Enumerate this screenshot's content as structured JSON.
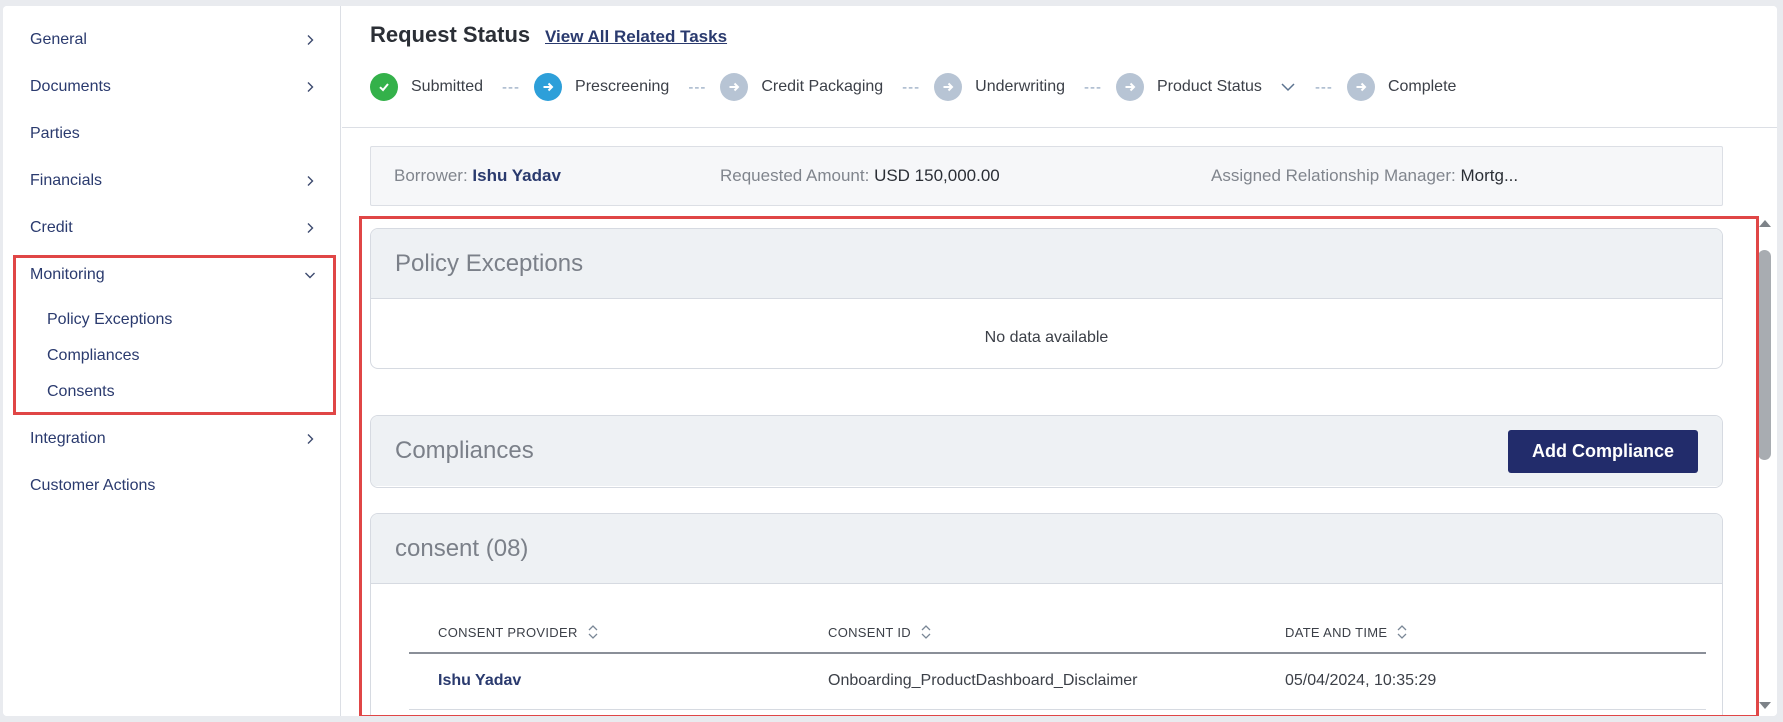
{
  "sidebar": {
    "items": [
      {
        "label": "General",
        "chevron": "right"
      },
      {
        "label": "Documents",
        "chevron": "right"
      },
      {
        "label": "Parties",
        "chevron": ""
      },
      {
        "label": "Financials",
        "chevron": "right"
      },
      {
        "label": "Credit",
        "chevron": "right"
      },
      {
        "label": "Monitoring",
        "chevron": "down"
      },
      {
        "label": "Integration",
        "chevron": "right"
      },
      {
        "label": "Customer Actions",
        "chevron": ""
      }
    ],
    "monitoring_sub": [
      "Policy Exceptions",
      "Compliances",
      "Consents"
    ]
  },
  "header": {
    "title": "Request Status",
    "link": "View All Related Tasks",
    "steps": [
      {
        "label": "Submitted",
        "state": "done"
      },
      {
        "label": "Prescreening",
        "state": "active"
      },
      {
        "label": "Credit Packaging",
        "state": "pending"
      },
      {
        "label": "Underwriting",
        "state": "pending"
      },
      {
        "label": "Product Status",
        "state": "pending"
      },
      {
        "label": "Complete",
        "state": "pending"
      }
    ],
    "dash": "---"
  },
  "info": {
    "borrower_label": "Borrower:",
    "borrower": "Ishu Yadav",
    "amount_label": "Requested Amount:",
    "amount": "USD 150,000.00",
    "manager_label": "Assigned Relationship Manager:",
    "manager": "Mortg..."
  },
  "policy": {
    "title": "Policy Exceptions",
    "empty": "No data available"
  },
  "compliances": {
    "title": "Compliances",
    "add_button": "Add Compliance"
  },
  "consent": {
    "title": "consent (08)",
    "columns": [
      "CONSENT PROVIDER",
      "CONSENT ID",
      "DATE AND TIME"
    ],
    "rows": [
      {
        "provider": "Ishu Yadav",
        "id": "Onboarding_ProductDashboard_Disclaimer",
        "datetime": "05/04/2024, 10:35:29"
      }
    ]
  },
  "colors": {
    "primary": "#222c6b",
    "link": "#2a3a6e",
    "done": "#34b14a",
    "active": "#2d9fd9",
    "pending": "#b7c4d4",
    "highlight": "#e04646"
  }
}
